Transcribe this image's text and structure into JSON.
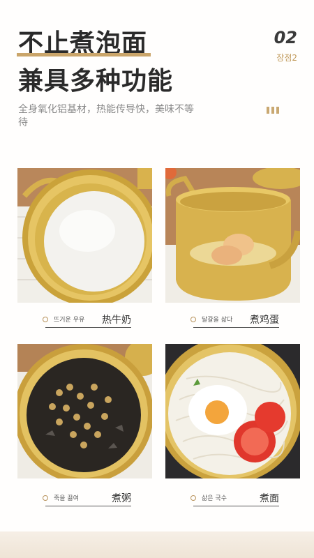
{
  "header": {
    "title_line1": "不止煮泡面",
    "title_line2": "兼具多种功能",
    "description": "全身氧化铝基材，热能传导快，美味不等待",
    "number": "02",
    "number_sub": "장점2"
  },
  "photos": [
    {
      "caption_kr": "뜨거운 우유",
      "caption_zh": "热牛奶"
    },
    {
      "caption_kr": "달걀을 삶다",
      "caption_zh": "煮鸡蛋"
    },
    {
      "caption_kr": "죽을 끓여",
      "caption_zh": "煮粥"
    },
    {
      "caption_kr": "삶은 국수",
      "caption_zh": "煮面"
    }
  ],
  "colors": {
    "accent_gold": "#c9a871",
    "text_dark": "#2a2a2a"
  }
}
